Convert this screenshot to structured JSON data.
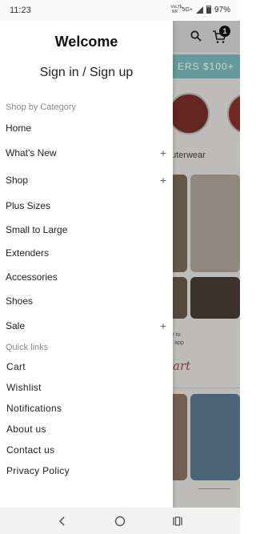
{
  "status_bar": {
    "time": "11:23",
    "volte": "VoLTE NR",
    "signal": "5G+",
    "battery": "97%"
  },
  "background": {
    "banner_text": "ERS $100+",
    "cart_count": "1",
    "category_label": "uterwear",
    "promo_text_line1": "e to",
    "promo_text_line2": "r app",
    "script_text": "art"
  },
  "drawer": {
    "welcome": "Welcome",
    "sign_in": "Sign in / Sign up",
    "shop_by_category_label": "Shop by Category",
    "categories": [
      {
        "label": "Home",
        "expandable": false
      },
      {
        "label": "What's New",
        "expandable": true
      },
      {
        "label": "Shop",
        "expandable": true
      },
      {
        "label": "Plus Sizes",
        "expandable": false
      },
      {
        "label": "Small to Large",
        "expandable": false
      },
      {
        "label": "Extenders",
        "expandable": false
      },
      {
        "label": "Accessories",
        "expandable": false
      },
      {
        "label": "Shoes",
        "expandable": false
      },
      {
        "label": "Sale",
        "expandable": true
      }
    ],
    "plus_glyph": "+",
    "quick_links_label": "Quick links",
    "quick_links": [
      "Cart",
      "Wishlist",
      "Notifications",
      "About us",
      "Contact us",
      "Privacy Policy"
    ]
  },
  "nav_bar": {
    "icons": [
      "back-icon",
      "home-icon",
      "recents-icon"
    ]
  },
  "colors": {
    "banner": "#7bbcbc",
    "drawer_bg": "#ffffff",
    "section_label": "#8a8a8a"
  }
}
